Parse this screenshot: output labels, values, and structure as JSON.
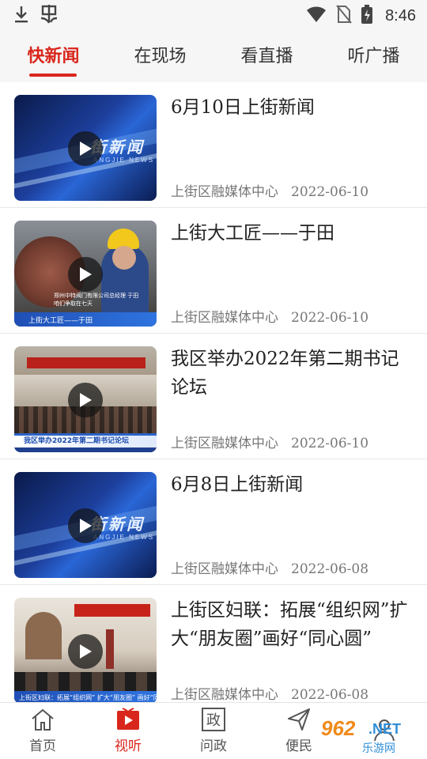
{
  "status_bar": {
    "time": "8:46",
    "left_icons": [
      "download-icon",
      "bug-icon"
    ],
    "right_icons": [
      "wifi-icon",
      "no-sim-icon",
      "battery-charging-icon"
    ]
  },
  "tabs": [
    {
      "label": "快新闻",
      "active": true
    },
    {
      "label": "在现场",
      "active": false
    },
    {
      "label": "看直播",
      "active": false
    },
    {
      "label": "听广播",
      "active": false
    }
  ],
  "news": [
    {
      "title": "6月10日上街新闻",
      "source": "上街区融媒体中心",
      "date": "2022-06-10",
      "thumb_logo": "街新闻",
      "thumb_sub": "ANGJIE NEWS"
    },
    {
      "title": "上街大工匠——于田",
      "source": "上街区融媒体中心",
      "date": "2022-06-10",
      "thumb_caption": "上街大工匠——于田",
      "thumb_sub": "郑州中特阀门有限公司总经理 于田\n咱们争取在七天"
    },
    {
      "title": "我区举办2022年第二期书记论坛",
      "source": "上街区融媒体中心",
      "date": "2022-06-10",
      "thumb_caption": "我区举办2022年第二期书记论坛"
    },
    {
      "title": "6月8日上街新闻",
      "source": "上街区融媒体中心",
      "date": "2022-06-08",
      "thumb_logo": "街新闻",
      "thumb_sub": "ANGJIE NEWS"
    },
    {
      "title": "上街区妇联：拓展“组织网”扩大“朋友圈”画好“同心圆”",
      "source": "上街区融媒体中心",
      "date": "2022-06-08",
      "thumb_caption": "上街区妇联：拓展“组织网” 扩大“朋友圈” 画好“同心"
    }
  ],
  "bottom_nav": [
    {
      "label": "首页",
      "icon": "home-icon",
      "active": false
    },
    {
      "label": "视听",
      "icon": "video-icon",
      "active": true
    },
    {
      "label": "问政",
      "icon": "zheng-icon",
      "active": false
    },
    {
      "label": "便民",
      "icon": "send-icon",
      "active": false
    },
    {
      "label": "",
      "icon": "user-icon",
      "active": false
    }
  ],
  "watermark": {
    "brand": "962",
    "suffix": ".NET",
    "sub": "乐游网"
  },
  "colors": {
    "accent": "#d9261c",
    "header_bg": "#f6f6f6",
    "meta_text": "#777777"
  }
}
